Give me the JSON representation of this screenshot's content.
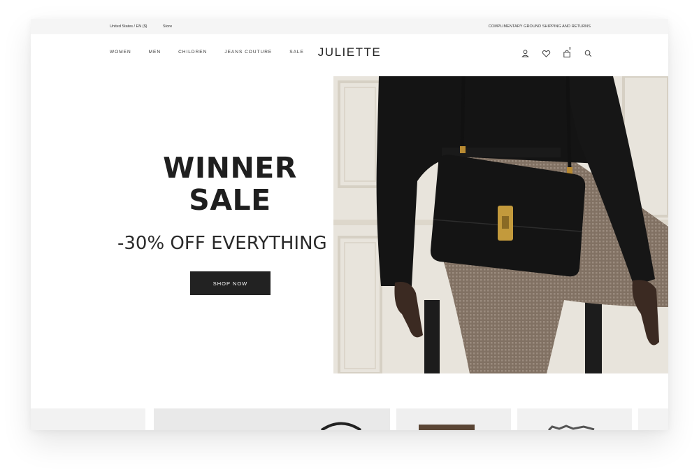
{
  "topbar": {
    "locale": "United States / EN ($)",
    "store": "Store",
    "promo": "COMPLIMENTARY GROUND SHIPPING AND RETURNS"
  },
  "nav": {
    "links": [
      "WOMEN",
      "MEN",
      "CHILDREN",
      "JEANS COUTURE",
      "SALE"
    ],
    "logo": "JULIETTE",
    "cart_count": "0",
    "icons": [
      "user-icon",
      "heart-icon",
      "bag-icon",
      "search-icon"
    ]
  },
  "hero": {
    "headline_line1": "WINNER",
    "headline_line2": "SALE",
    "subline": "-30% OFF EVERYTHING",
    "cta_label": "SHOP NOW",
    "image_alt": "model-with-black-handbag"
  },
  "colors": {
    "accent": "#222222",
    "topbar_bg": "#f5f5f5",
    "page_bg": "#ffffff"
  }
}
